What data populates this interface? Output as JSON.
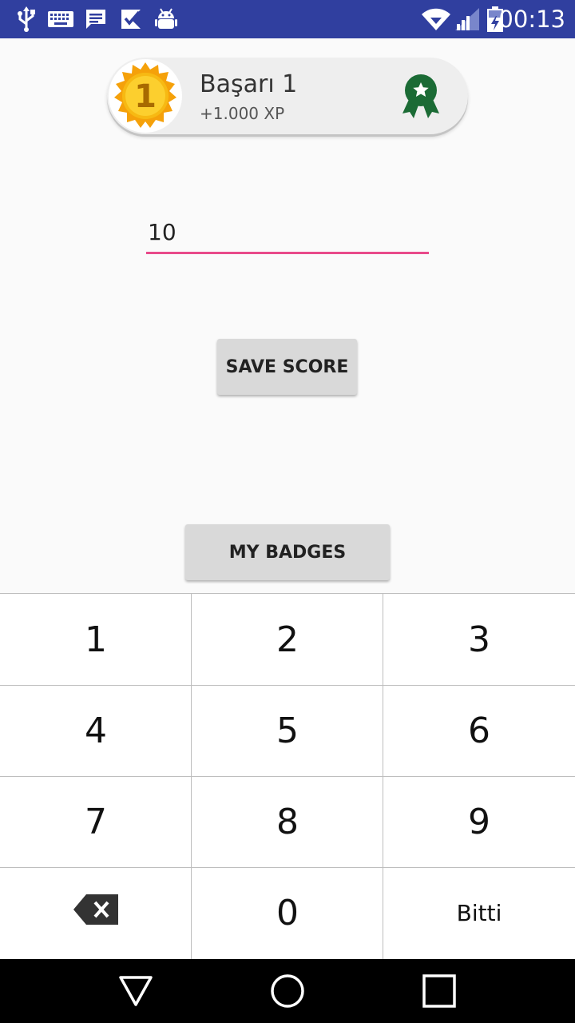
{
  "status_bar": {
    "time": "00:13",
    "icons": [
      "usb-icon",
      "keyboard-icon",
      "message-icon",
      "task-icon",
      "android-debug-icon",
      "wifi-icon",
      "signal-icon",
      "battery-charging-icon"
    ],
    "background": "#303f9f"
  },
  "badge": {
    "medal_number": "1",
    "title": "Başarı 1",
    "xp": "+1.000 XP",
    "ribbon_color": "#1b6b35"
  },
  "score_input": {
    "value": "10",
    "underline_color": "#e84a8a"
  },
  "buttons": {
    "save_score": "SAVE SCORE",
    "my_badges": "MY BADGES"
  },
  "keyboard": {
    "keys": [
      "1",
      "2",
      "3",
      "4",
      "5",
      "6",
      "7",
      "8",
      "9",
      "",
      "0",
      "Bitti"
    ],
    "backspace_icon": "backspace-icon",
    "done_label": "Bitti"
  },
  "nav_bar": {
    "icons": [
      "back-triangle-icon",
      "home-circle-icon",
      "recents-square-icon"
    ]
  }
}
